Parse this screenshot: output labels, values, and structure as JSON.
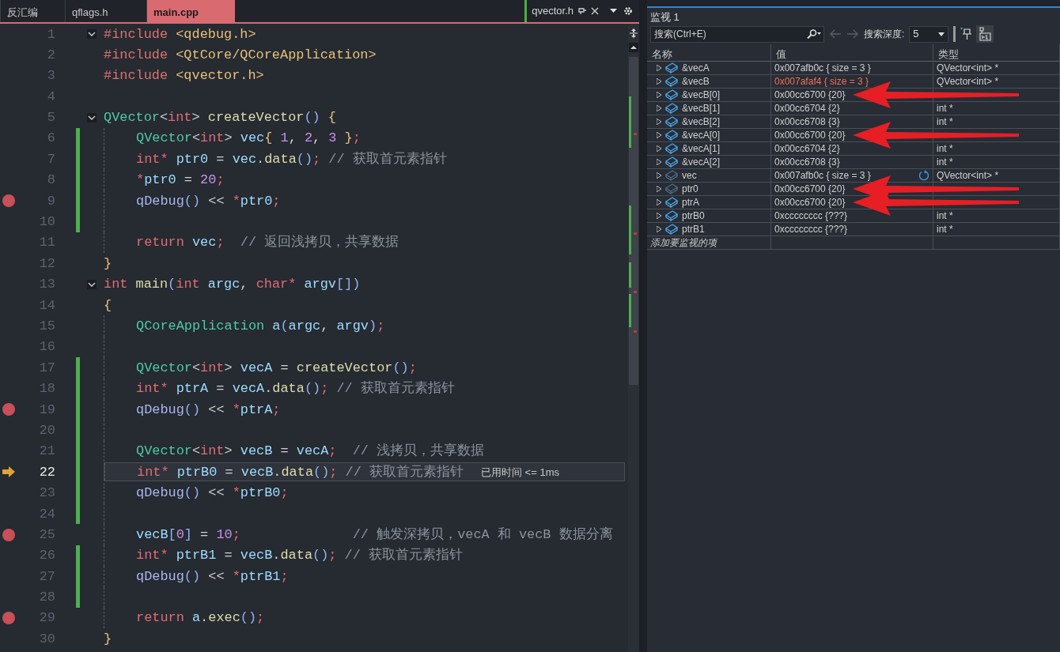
{
  "tabs": [
    {
      "label": "反汇编",
      "selected": false
    },
    {
      "label": "qflags.h",
      "selected": false
    },
    {
      "label": "main.cpp",
      "selected": true
    }
  ],
  "pinned_tab": {
    "label": "qvector.h"
  },
  "lines": [
    {
      "number": "1",
      "fold": true,
      "indent": false,
      "changed": false,
      "breakpoint": false,
      "current": false,
      "tokens": [
        {
          "kind": "pp",
          "text": "#include"
        },
        {
          "kind": "hdr",
          "text": " <qdebug.h>"
        }
      ]
    },
    {
      "number": "2",
      "fold": false,
      "indent": false,
      "changed": false,
      "breakpoint": false,
      "current": false,
      "tokens": [
        {
          "kind": "pp",
          "text": "#include"
        },
        {
          "kind": "hdr",
          "text": " <QtCore/QCoreApplication>"
        }
      ]
    },
    {
      "number": "3",
      "fold": false,
      "indent": false,
      "changed": false,
      "breakpoint": false,
      "current": false,
      "tokens": [
        {
          "kind": "pp",
          "text": "#include"
        },
        {
          "kind": "hdr",
          "text": " <qvector.h>"
        }
      ]
    },
    {
      "number": "4",
      "fold": false,
      "indent": false,
      "changed": false,
      "breakpoint": false,
      "current": false
    },
    {
      "number": "5",
      "fold": true,
      "indent": false,
      "changed": false,
      "breakpoint": false,
      "current": false,
      "tokens": [
        {
          "kind": "type",
          "text": "QVector"
        },
        {
          "kind": "op",
          "text": "<"
        },
        {
          "kind": "kw",
          "text": "int"
        },
        {
          "kind": "op",
          "text": "> "
        },
        {
          "kind": "fn",
          "text": "createVector"
        },
        {
          "kind": "par",
          "text": "()"
        },
        {
          "kind": "br",
          "text": " {"
        }
      ]
    },
    {
      "number": "6",
      "fold": false,
      "indent": true,
      "changed": true,
      "breakpoint": false,
      "current": false,
      "tokens": [
        {
          "kind": "type",
          "text": "QVector"
        },
        {
          "kind": "op",
          "text": "<"
        },
        {
          "kind": "kw",
          "text": "int"
        },
        {
          "kind": "op",
          "text": "> "
        },
        {
          "kind": "var",
          "text": "vec"
        },
        {
          "kind": "br",
          "text": "{ "
        },
        {
          "kind": "num",
          "text": "1"
        },
        {
          "kind": "op",
          "text": ", "
        },
        {
          "kind": "num",
          "text": "2"
        },
        {
          "kind": "op",
          "text": ", "
        },
        {
          "kind": "num",
          "text": "3"
        },
        {
          "kind": "br",
          "text": " }"
        },
        {
          "kind": "semi",
          "text": ";"
        }
      ]
    },
    {
      "number": "7",
      "fold": false,
      "indent": true,
      "changed": true,
      "breakpoint": false,
      "current": false,
      "tokens": [
        {
          "kind": "kw",
          "text": "int*"
        },
        {
          "kind": "var",
          "text": " ptr0"
        },
        {
          "kind": "op",
          "text": " = "
        },
        {
          "kind": "var",
          "text": "vec"
        },
        {
          "kind": "op",
          "text": "."
        },
        {
          "kind": "fn",
          "text": "data"
        },
        {
          "kind": "par",
          "text": "()"
        },
        {
          "kind": "semi",
          "text": ";"
        },
        {
          "kind": "cmt",
          "text": " // 获取首元素指针"
        }
      ]
    },
    {
      "number": "8",
      "fold": false,
      "indent": true,
      "changed": true,
      "breakpoint": false,
      "current": false,
      "tokens": [
        {
          "kind": "kw",
          "text": "*"
        },
        {
          "kind": "var",
          "text": "ptr0"
        },
        {
          "kind": "op",
          "text": " = "
        },
        {
          "kind": "num",
          "text": "20"
        },
        {
          "kind": "semi",
          "text": ";"
        }
      ]
    },
    {
      "number": "9",
      "fold": false,
      "indent": true,
      "changed": true,
      "breakpoint": true,
      "current": false,
      "tokens": [
        {
          "kind": "mac",
          "text": "qDebug"
        },
        {
          "kind": "par",
          "text": "()"
        },
        {
          "kind": "op",
          "text": " << "
        },
        {
          "kind": "kw",
          "text": "*"
        },
        {
          "kind": "var",
          "text": "ptr0"
        },
        {
          "kind": "semi",
          "text": ";"
        }
      ]
    },
    {
      "number": "10",
      "fold": false,
      "indent": true,
      "changed": true,
      "breakpoint": false,
      "current": false
    },
    {
      "number": "11",
      "fold": false,
      "indent": true,
      "changed": false,
      "breakpoint": false,
      "current": false,
      "tokens": [
        {
          "kind": "kw",
          "text": "return"
        },
        {
          "kind": "var",
          "text": " vec"
        },
        {
          "kind": "semi",
          "text": ";"
        },
        {
          "kind": "cmt",
          "text": "  // 返回浅拷贝，共享数据"
        }
      ]
    },
    {
      "number": "12",
      "fold": false,
      "indent": false,
      "changed": false,
      "breakpoint": false,
      "current": false,
      "tokens": [
        {
          "kind": "br",
          "text": "}"
        }
      ]
    },
    {
      "number": "13",
      "fold": true,
      "indent": false,
      "changed": false,
      "breakpoint": false,
      "current": false,
      "tokens": [
        {
          "kind": "kw",
          "text": "int"
        },
        {
          "kind": "fn",
          "text": " main"
        },
        {
          "kind": "par",
          "text": "("
        },
        {
          "kind": "kw",
          "text": "int"
        },
        {
          "kind": "var",
          "text": " argc"
        },
        {
          "kind": "op",
          "text": ", "
        },
        {
          "kind": "kw",
          "text": "char*"
        },
        {
          "kind": "var",
          "text": " argv"
        },
        {
          "kind": "par",
          "text": "[])"
        }
      ]
    },
    {
      "number": "14",
      "fold": false,
      "indent": false,
      "changed": false,
      "breakpoint": false,
      "current": false,
      "tokens": [
        {
          "kind": "br",
          "text": "{"
        }
      ]
    },
    {
      "number": "15",
      "fold": false,
      "indent": true,
      "changed": false,
      "breakpoint": false,
      "current": false,
      "tokens": [
        {
          "kind": "type",
          "text": "QCoreApplication"
        },
        {
          "kind": "var",
          "text": " a"
        },
        {
          "kind": "par",
          "text": "("
        },
        {
          "kind": "var",
          "text": "argc"
        },
        {
          "kind": "op",
          "text": ", "
        },
        {
          "kind": "var",
          "text": "argv"
        },
        {
          "kind": "par",
          "text": ")"
        },
        {
          "kind": "semi",
          "text": ";"
        }
      ]
    },
    {
      "number": "16",
      "fold": false,
      "indent": true,
      "changed": false,
      "breakpoint": false,
      "current": false
    },
    {
      "number": "17",
      "fold": false,
      "indent": true,
      "changed": true,
      "breakpoint": false,
      "current": false,
      "tokens": [
        {
          "kind": "type",
          "text": "QVector"
        },
        {
          "kind": "op",
          "text": "<"
        },
        {
          "kind": "kw",
          "text": "int"
        },
        {
          "kind": "op",
          "text": "> "
        },
        {
          "kind": "var",
          "text": "vecA"
        },
        {
          "kind": "op",
          "text": " = "
        },
        {
          "kind": "fn",
          "text": "createVector"
        },
        {
          "kind": "par",
          "text": "()"
        },
        {
          "kind": "semi",
          "text": ";"
        }
      ]
    },
    {
      "number": "18",
      "fold": false,
      "indent": true,
      "changed": true,
      "breakpoint": false,
      "current": false,
      "tokens": [
        {
          "kind": "kw",
          "text": "int*"
        },
        {
          "kind": "var",
          "text": " ptrA"
        },
        {
          "kind": "op",
          "text": " = "
        },
        {
          "kind": "var",
          "text": "vecA"
        },
        {
          "kind": "op",
          "text": "."
        },
        {
          "kind": "fn",
          "text": "data"
        },
        {
          "kind": "par",
          "text": "()"
        },
        {
          "kind": "semi",
          "text": ";"
        },
        {
          "kind": "cmt",
          "text": " // 获取首元素指针"
        }
      ]
    },
    {
      "number": "19",
      "fold": false,
      "indent": true,
      "changed": true,
      "breakpoint": true,
      "current": false,
      "tokens": [
        {
          "kind": "mac",
          "text": "qDebug"
        },
        {
          "kind": "par",
          "text": "()"
        },
        {
          "kind": "op",
          "text": " << "
        },
        {
          "kind": "kw",
          "text": "*"
        },
        {
          "kind": "var",
          "text": "ptrA"
        },
        {
          "kind": "semi",
          "text": ";"
        }
      ]
    },
    {
      "number": "20",
      "fold": false,
      "indent": true,
      "changed": true,
      "breakpoint": false,
      "current": false
    },
    {
      "number": "21",
      "fold": false,
      "indent": true,
      "changed": true,
      "breakpoint": false,
      "current": false,
      "tokens": [
        {
          "kind": "type",
          "text": "QVector"
        },
        {
          "kind": "op",
          "text": "<"
        },
        {
          "kind": "kw",
          "text": "int"
        },
        {
          "kind": "op",
          "text": "> "
        },
        {
          "kind": "var",
          "text": "vecB"
        },
        {
          "kind": "op",
          "text": " = "
        },
        {
          "kind": "var",
          "text": "vecA"
        },
        {
          "kind": "semi",
          "text": ";"
        },
        {
          "kind": "cmt",
          "text": "  // 浅拷贝，共享数据"
        }
      ]
    },
    {
      "number": "22",
      "fold": false,
      "indent": true,
      "changed": true,
      "breakpoint": false,
      "current": true,
      "hint": "已用时间 <= 1ms",
      "tokens": [
        {
          "kind": "kw",
          "text": "int*"
        },
        {
          "kind": "var",
          "text": " ptrB0"
        },
        {
          "kind": "op",
          "text": " = "
        },
        {
          "kind": "var",
          "text": "vecB"
        },
        {
          "kind": "op",
          "text": "."
        },
        {
          "kind": "fn",
          "text": "data"
        },
        {
          "kind": "par",
          "text": "()"
        },
        {
          "kind": "semi",
          "text": ";"
        },
        {
          "kind": "cmt",
          "text": " // 获取首元素指针"
        }
      ]
    },
    {
      "number": "23",
      "fold": false,
      "indent": true,
      "changed": true,
      "breakpoint": false,
      "current": false,
      "tokens": [
        {
          "kind": "mac",
          "text": "qDebug"
        },
        {
          "kind": "par",
          "text": "()"
        },
        {
          "kind": "op",
          "text": " << "
        },
        {
          "kind": "kw",
          "text": "*"
        },
        {
          "kind": "var",
          "text": "ptrB0"
        },
        {
          "kind": "semi",
          "text": ";"
        }
      ]
    },
    {
      "number": "24",
      "fold": false,
      "indent": true,
      "changed": true,
      "breakpoint": false,
      "current": false
    },
    {
      "number": "25",
      "fold": false,
      "indent": true,
      "changed": false,
      "breakpoint": true,
      "current": false,
      "tokens": [
        {
          "kind": "var",
          "text": "vecB"
        },
        {
          "kind": "par",
          "text": "["
        },
        {
          "kind": "num",
          "text": "0"
        },
        {
          "kind": "par",
          "text": "]"
        },
        {
          "kind": "op",
          "text": " = "
        },
        {
          "kind": "num",
          "text": "10"
        },
        {
          "kind": "semi",
          "text": ";"
        },
        {
          "kind": "cmt",
          "text": "              // 触发深拷贝，vecA 和 vecB 数据分离"
        }
      ]
    },
    {
      "number": "26",
      "fold": false,
      "indent": true,
      "changed": true,
      "breakpoint": false,
      "current": false,
      "tokens": [
        {
          "kind": "kw",
          "text": "int*"
        },
        {
          "kind": "var",
          "text": " ptrB1"
        },
        {
          "kind": "op",
          "text": " = "
        },
        {
          "kind": "var",
          "text": "vecB"
        },
        {
          "kind": "op",
          "text": "."
        },
        {
          "kind": "fn",
          "text": "data"
        },
        {
          "kind": "par",
          "text": "()"
        },
        {
          "kind": "semi",
          "text": ";"
        },
        {
          "kind": "cmt",
          "text": " // 获取首元素指针"
        }
      ]
    },
    {
      "number": "27",
      "fold": false,
      "indent": true,
      "changed": true,
      "breakpoint": false,
      "current": false,
      "tokens": [
        {
          "kind": "mac",
          "text": "qDebug"
        },
        {
          "kind": "par",
          "text": "()"
        },
        {
          "kind": "op",
          "text": " << "
        },
        {
          "kind": "kw",
          "text": "*"
        },
        {
          "kind": "var",
          "text": "ptrB1"
        },
        {
          "kind": "semi",
          "text": ";"
        }
      ]
    },
    {
      "number": "28",
      "fold": false,
      "indent": true,
      "changed": true,
      "breakpoint": false,
      "current": false
    },
    {
      "number": "29",
      "fold": false,
      "indent": true,
      "changed": false,
      "breakpoint": true,
      "current": false,
      "tokens": [
        {
          "kind": "kw",
          "text": "return"
        },
        {
          "kind": "var",
          "text": " a"
        },
        {
          "kind": "op",
          "text": "."
        },
        {
          "kind": "fn",
          "text": "exec"
        },
        {
          "kind": "par",
          "text": "()"
        },
        {
          "kind": "semi",
          "text": ";"
        }
      ]
    },
    {
      "number": "30",
      "fold": false,
      "indent": false,
      "changed": false,
      "breakpoint": false,
      "current": false,
      "tokens": [
        {
          "kind": "br",
          "text": "}"
        }
      ]
    }
  ],
  "watch": {
    "title": "监视 1",
    "search": {
      "placeholder": "搜索(Ctrl+E)"
    },
    "depth_label": "搜索深度:",
    "depth": "5",
    "columns": [
      "名称",
      "值",
      "类型"
    ],
    "rows": [
      {
        "name": "&vecA",
        "value": "0x007afb0c { size = 3 }",
        "type": "QVector<int> *",
        "changed": false,
        "stale": false,
        "refresh": false,
        "arrow": false
      },
      {
        "name": "&vecB",
        "value": "0x007afaf4 { size = 3 }",
        "type": "QVector<int> *",
        "changed": true,
        "stale": false,
        "refresh": false,
        "arrow": false
      },
      {
        "name": "&vecB[0]",
        "value": "0x00cc6700 {20}",
        "changed": false,
        "stale": false,
        "refresh": false,
        "arrow": true
      },
      {
        "name": "&vecB[1]",
        "value": "0x00cc6704 {2}",
        "type": "int *",
        "changed": false,
        "stale": false,
        "refresh": false,
        "arrow": false
      },
      {
        "name": "&vecB[2]",
        "value": "0x00cc6708 {3}",
        "type": "int *",
        "changed": false,
        "stale": false,
        "refresh": false,
        "arrow": false
      },
      {
        "name": "&vecA[0]",
        "value": "0x00cc6700 {20}",
        "changed": false,
        "stale": false,
        "refresh": false,
        "arrow": true
      },
      {
        "name": "&vecA[1]",
        "value": "0x00cc6704 {2}",
        "type": "int *",
        "changed": false,
        "stale": false,
        "refresh": false,
        "arrow": false
      },
      {
        "name": "&vecA[2]",
        "value": "0x00cc6708 {3}",
        "type": "int *",
        "changed": false,
        "stale": false,
        "refresh": false,
        "arrow": false
      },
      {
        "name": "vec",
        "value": "0x007afb0c { size = 3 }",
        "type": "QVector<int> *",
        "changed": false,
        "stale": true,
        "refresh": true,
        "arrow": false
      },
      {
        "name": "ptr0",
        "value": "0x00cc6700 {20}",
        "changed": false,
        "stale": true,
        "refresh": false,
        "arrow": true
      },
      {
        "name": "ptrA",
        "value": "0x00cc6700 {20}",
        "changed": false,
        "stale": false,
        "refresh": false,
        "arrow": true
      },
      {
        "name": "ptrB0",
        "value": "0xcccccccc {???}",
        "type": "int *",
        "changed": false,
        "stale": false,
        "refresh": false,
        "arrow": false
      },
      {
        "name": "ptrB1",
        "value": "0xcccccccc {???}",
        "type": "int *",
        "changed": false,
        "stale": false,
        "refresh": false,
        "arrow": false
      }
    ],
    "add_hint": "添加要监视的项"
  }
}
